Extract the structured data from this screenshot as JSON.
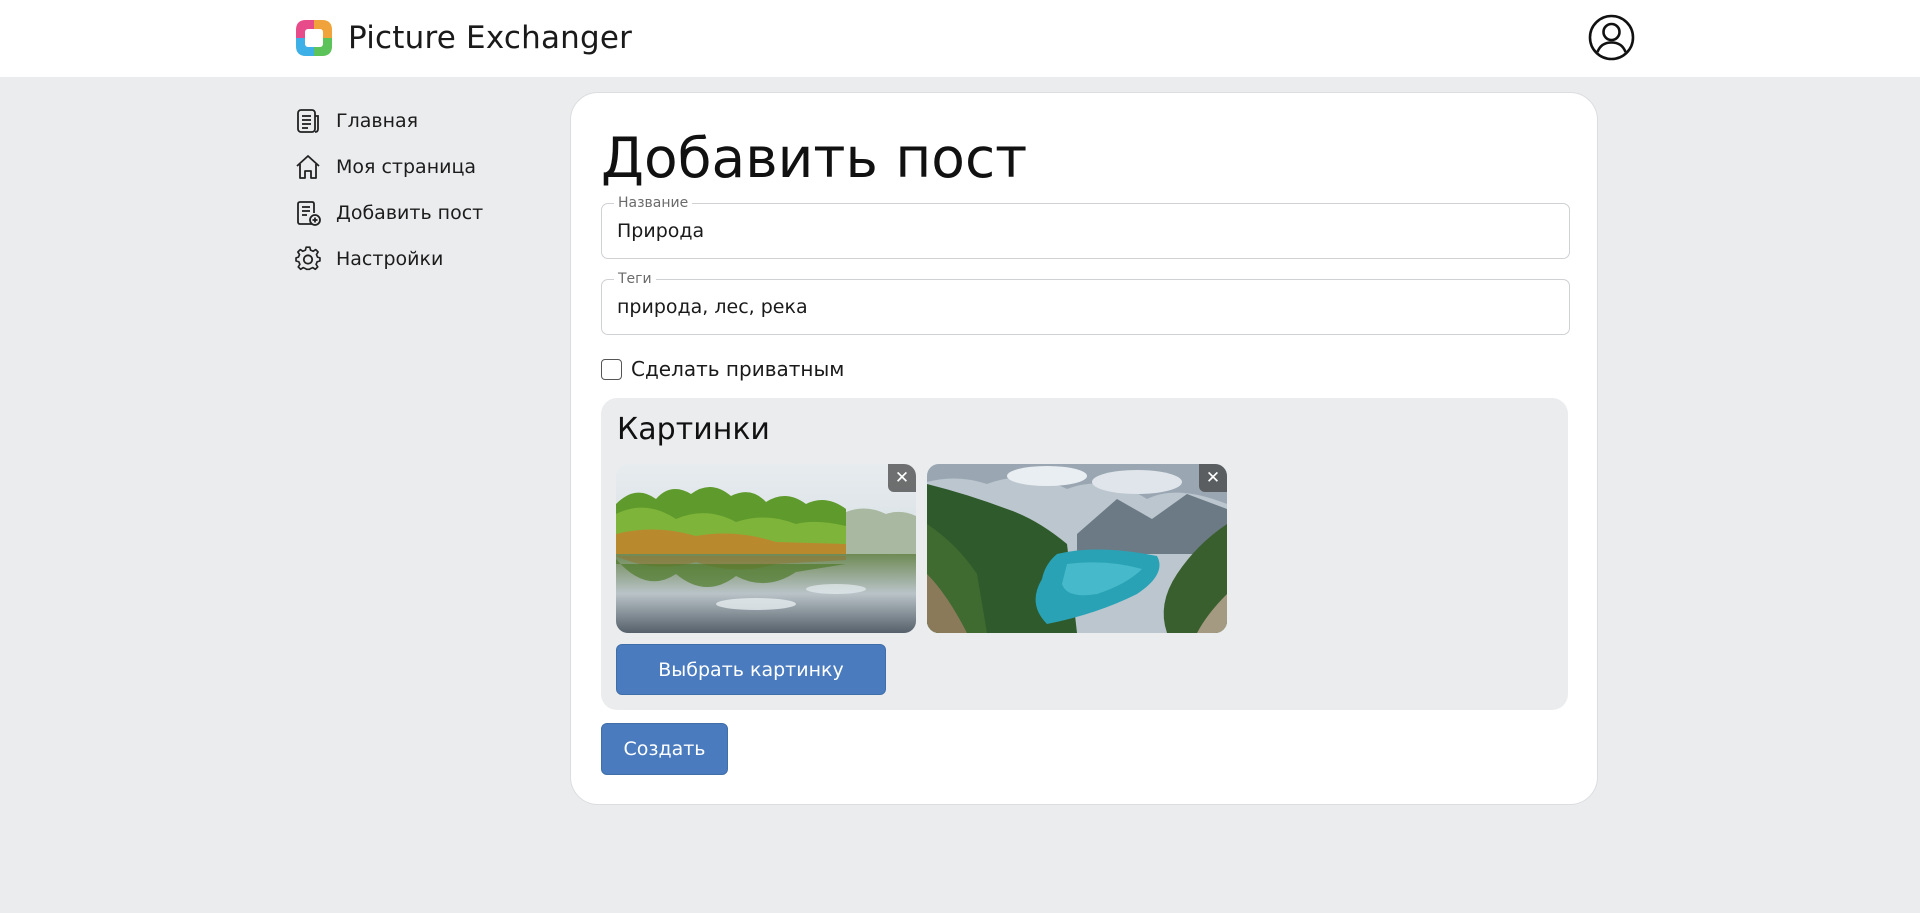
{
  "header": {
    "app_title": "Picture Exchanger",
    "logo_icon": "colorful-square-logo",
    "profile_icon": "user-circle-icon"
  },
  "sidebar": {
    "items": [
      {
        "label": "Главная",
        "icon": "document-icon"
      },
      {
        "label": "Моя страница",
        "icon": "home-icon"
      },
      {
        "label": "Добавить пост",
        "icon": "add-document-icon"
      },
      {
        "label": "Настройки",
        "icon": "gear-icon"
      }
    ]
  },
  "form": {
    "title": "Добавить пост",
    "name_field": {
      "legend": "Название",
      "value": "Природа"
    },
    "tags_field": {
      "legend": "Теги",
      "value": "природа, лес, река"
    },
    "private_checkbox": {
      "label": "Сделать приватным",
      "checked": false
    },
    "pictures": {
      "title": "Картинки",
      "items": [
        {
          "description": "forest-lake-reflection",
          "remove_label": "✕"
        },
        {
          "description": "mountain-lake-valley",
          "remove_label": "✕"
        }
      ],
      "choose_button": "Выбрать картинку"
    },
    "submit_button": "Создать"
  },
  "colors": {
    "background": "#ebecee",
    "accent_button": "#4a7bbe",
    "card": "#ffffff"
  }
}
